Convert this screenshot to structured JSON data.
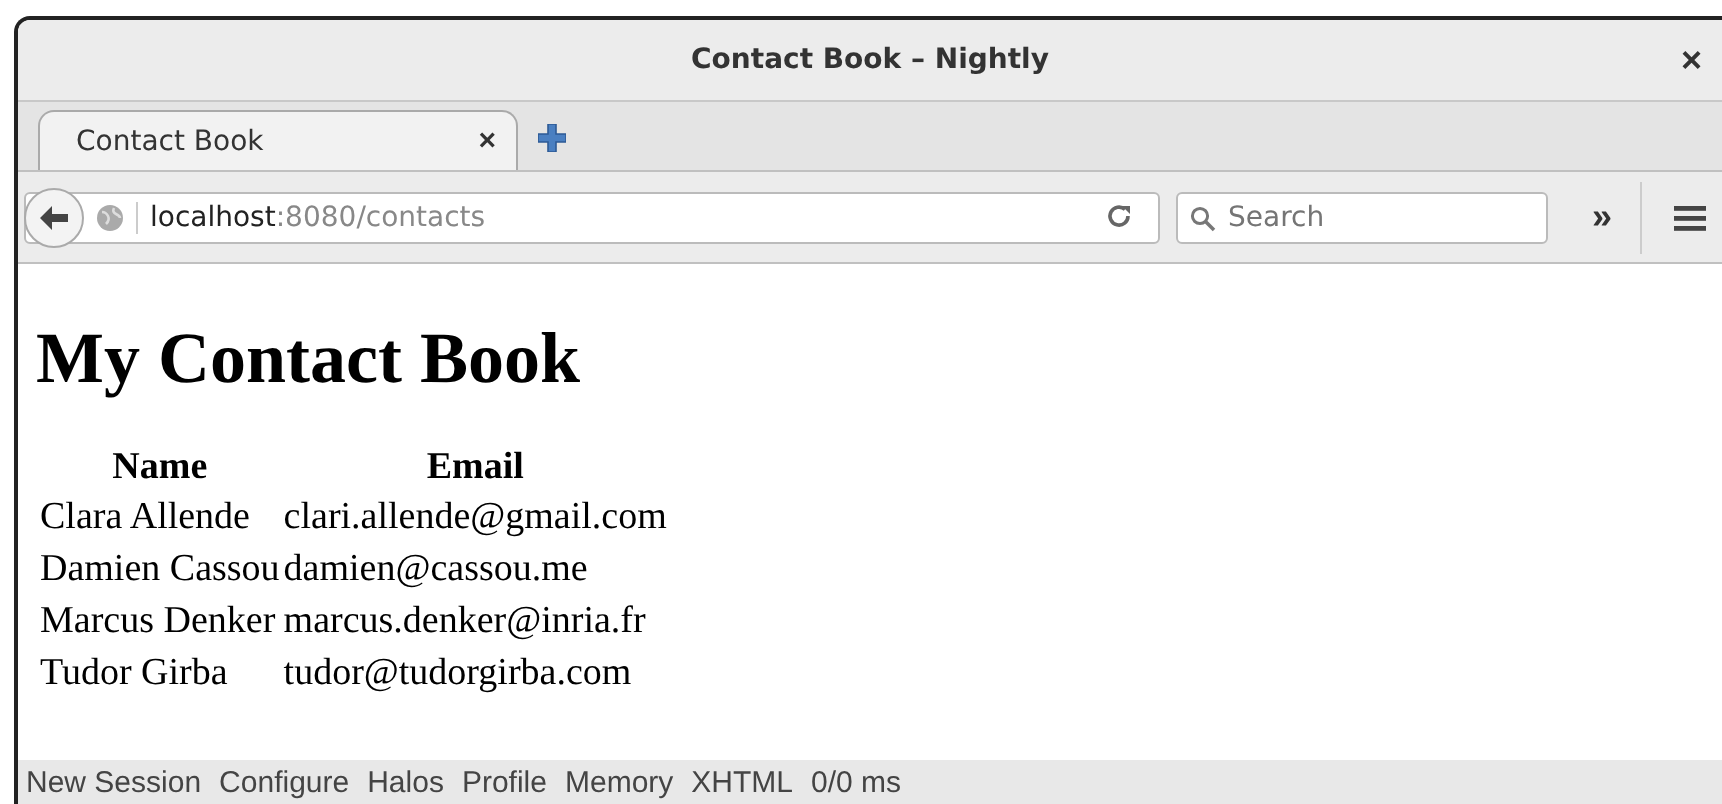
{
  "window": {
    "title": "Contact Book – Nightly",
    "close": "×"
  },
  "tabs": [
    {
      "label": "Contact Book",
      "selected": true,
      "close": "×"
    }
  ],
  "address": {
    "host": "localhost",
    "path": ":8080/contacts"
  },
  "search": {
    "placeholder": "Search"
  },
  "overflow": "»",
  "page": {
    "heading": "My Contact Book",
    "table": {
      "columns": [
        "Name",
        "Email"
      ],
      "rows": [
        [
          "Clara Allende",
          "clari.allende@gmail.com"
        ],
        [
          "Damien Cassou",
          "damien@cassou.me"
        ],
        [
          "Marcus Denker",
          "marcus.denker@inria.fr"
        ],
        [
          "Tudor Girba",
          "tudor@tudorgirba.com"
        ]
      ]
    }
  },
  "toolbar": {
    "links": [
      "New Session",
      "Configure",
      "Halos",
      "Profile",
      "Memory",
      "XHTML"
    ],
    "timing": "0/0 ms"
  }
}
